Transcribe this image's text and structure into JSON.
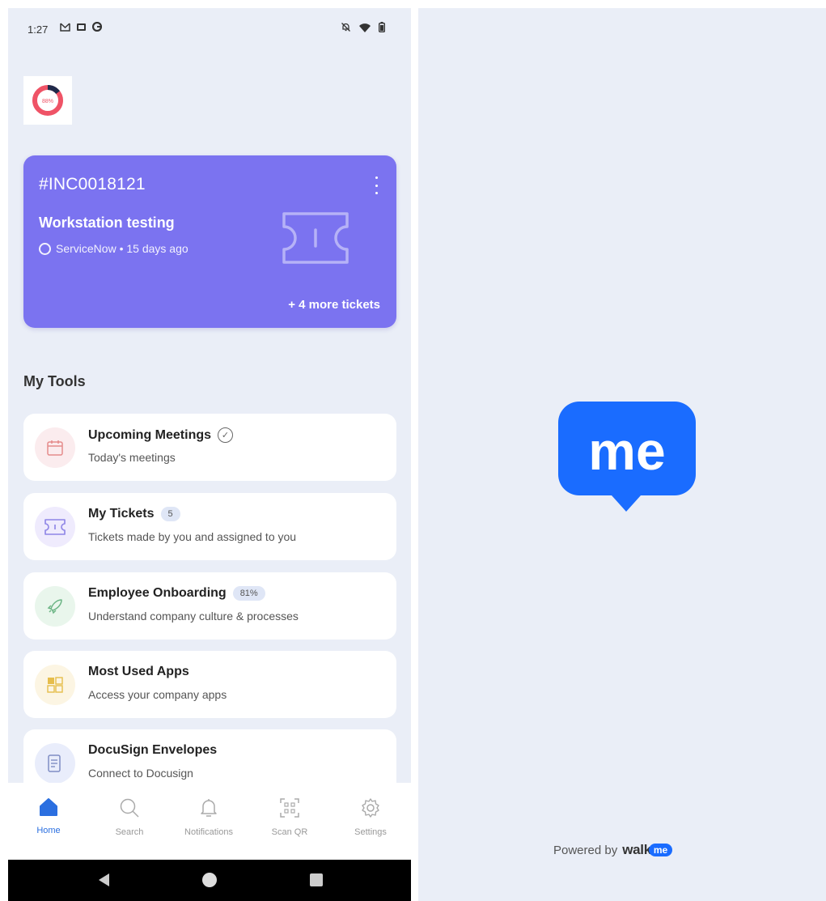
{
  "status_bar": {
    "time": "1:27"
  },
  "logo": {
    "percent_text": "88%",
    "ring_color": "#ef5366"
  },
  "ticket": {
    "id": "#INC0018121",
    "title": "Workstation testing",
    "source": "ServiceNow • 15 days ago",
    "more": "+ 4 more tickets",
    "bg_color": "#7b73f0"
  },
  "tools": {
    "heading": "My Tools",
    "items": [
      {
        "title": "Upcoming Meetings",
        "subtitle": "Today's meetings",
        "icon": "calendar-icon"
      },
      {
        "title": "My Tickets",
        "badge": "5",
        "subtitle": "Tickets made by you and assigned to you",
        "icon": "ticket-icon"
      },
      {
        "title": "Employee Onboarding",
        "badge": "81%",
        "subtitle": "Understand company culture & processes",
        "icon": "rocket-icon"
      },
      {
        "title": "Most Used Apps",
        "subtitle": "Access your company apps",
        "icon": "apps-grid-icon"
      },
      {
        "title": "DocuSign Envelopes",
        "subtitle": "Connect to Docusign",
        "icon": "document-icon"
      }
    ]
  },
  "nav": {
    "items": [
      {
        "label": "Home",
        "icon": "home-icon",
        "active": true
      },
      {
        "label": "Search",
        "icon": "search-icon"
      },
      {
        "label": "Notifications",
        "icon": "bell-icon"
      },
      {
        "label": "Scan QR",
        "icon": "qr-icon"
      },
      {
        "label": "Settings",
        "icon": "gear-icon"
      }
    ],
    "active_color": "#2b6fe0"
  },
  "splash": {
    "logo_text": "me",
    "logo_color": "#1a6cff",
    "powered_by": "Powered by",
    "brand_word": "walk",
    "brand_me": "me"
  }
}
